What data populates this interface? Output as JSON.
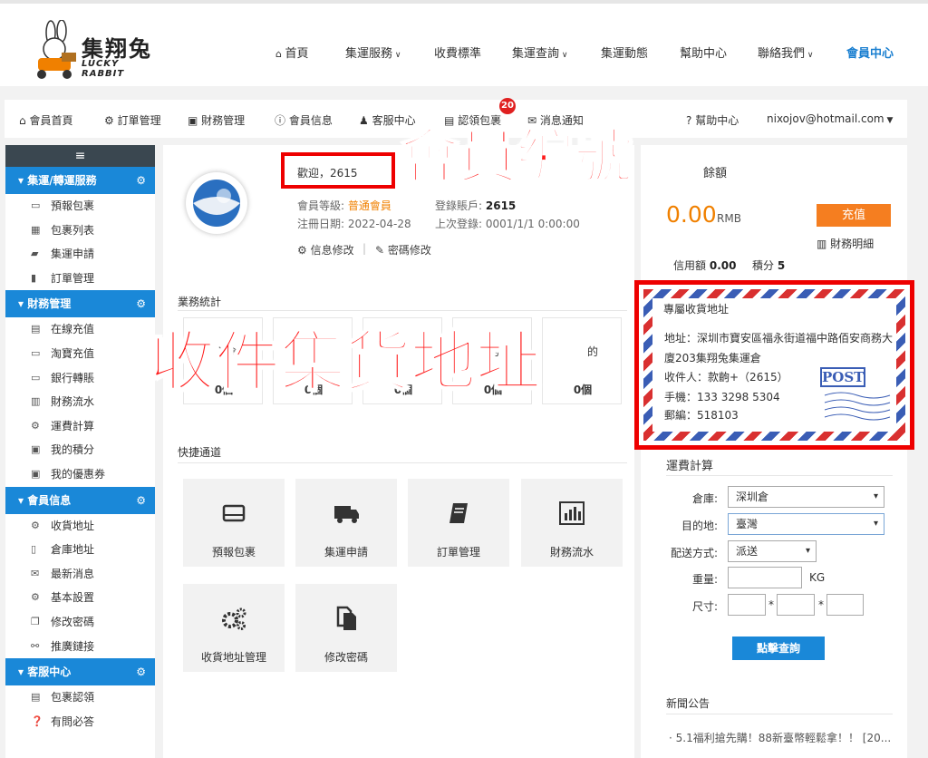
{
  "brand": {
    "name": "集翔兔",
    "sub": "LUCKY RABBIT"
  },
  "nav": [
    "首頁",
    "集運服務",
    "收費標準",
    "集運查詢",
    "集運動態",
    "幫助中心",
    "聯絡我們",
    "會員中心"
  ],
  "subnav": {
    "items": [
      "會員首頁",
      "訂單管理",
      "財務管理",
      "會員信息",
      "客服中心",
      "認領包裹",
      "消息通知",
      "幫助中心"
    ],
    "badge": "20",
    "email": "nixojov@hotmail.com"
  },
  "sidebar": {
    "hamburger": "≡",
    "groups": [
      {
        "title": "集運/轉運服務",
        "items": [
          "預報包裹",
          "包裹列表",
          "集運申請",
          "訂單管理"
        ]
      },
      {
        "title": "財務管理",
        "items": [
          "在線充值",
          "淘寶充值",
          "銀行轉賬",
          "財務流水",
          "運費計算",
          "我的積分",
          "我的優惠券"
        ]
      },
      {
        "title": "會員信息",
        "items": [
          "收貨地址",
          "倉庫地址",
          "最新消息",
          "基本設置",
          "修改密碼",
          "推廣鏈接"
        ]
      },
      {
        "title": "客服中心",
        "items": [
          "包裹認領",
          "有問必答"
        ]
      }
    ]
  },
  "profile": {
    "welcome": "歡迎，2615",
    "level_label": "會員等級:",
    "level_value": "普通會員",
    "account_label": "登錄賬戶:",
    "account_value": "2615",
    "reg_label": "注冊日期:",
    "reg_value": "2022-04-28",
    "last_label": "上次登錄:",
    "last_value": "0001/1/1 0:00:00",
    "edit_info": "信息修改",
    "edit_pwd": "密碼修改"
  },
  "balance": {
    "label": "餘額",
    "amount": "0.00",
    "currency": "RMB",
    "recharge": "充值",
    "details": "財務明細",
    "credit_label": "信用額",
    "credit_value": "0.00",
    "points_label": "積分",
    "points_value": "5"
  },
  "stats": {
    "title": "業務統計",
    "labels": [
      "入倉",
      "已入",
      "已",
      "的",
      "的"
    ],
    "values": [
      "0個",
      "0個",
      "0個",
      "0個",
      "0個"
    ]
  },
  "quick": {
    "title": "快捷通道",
    "items": [
      "預報包裹",
      "集運申請",
      "訂單管理",
      "財務流水",
      "收貨地址管理",
      "修改密碼"
    ]
  },
  "overlay": {
    "member_id": "會員編號",
    "address": "收件集貨地址"
  },
  "address": {
    "title": "專屬收貨地址",
    "line1": "地址：深圳市寶安區福永街道福中路佰安商務大",
    "line2": "廈203集翔兔集運倉",
    "recipient": "收件人：款齣+（2615）",
    "phone": "手機：133 3298 5304",
    "zip": "郵編：518103",
    "stamp": "POST"
  },
  "calc": {
    "title": "運費計算",
    "warehouse_label": "倉庫:",
    "warehouse_value": "深圳倉",
    "dest_label": "目的地:",
    "dest_value": "臺灣",
    "method_label": "配送方式:",
    "method_value": "派送",
    "weight_label": "重量:",
    "weight_unit": "KG",
    "size_label": "尺寸:",
    "times": "*",
    "submit": "點擊查詢"
  },
  "news": {
    "title": "新聞公告",
    "item": "· 5.1福利搶先購！88新臺幣輕鬆拿！！ [20..."
  }
}
